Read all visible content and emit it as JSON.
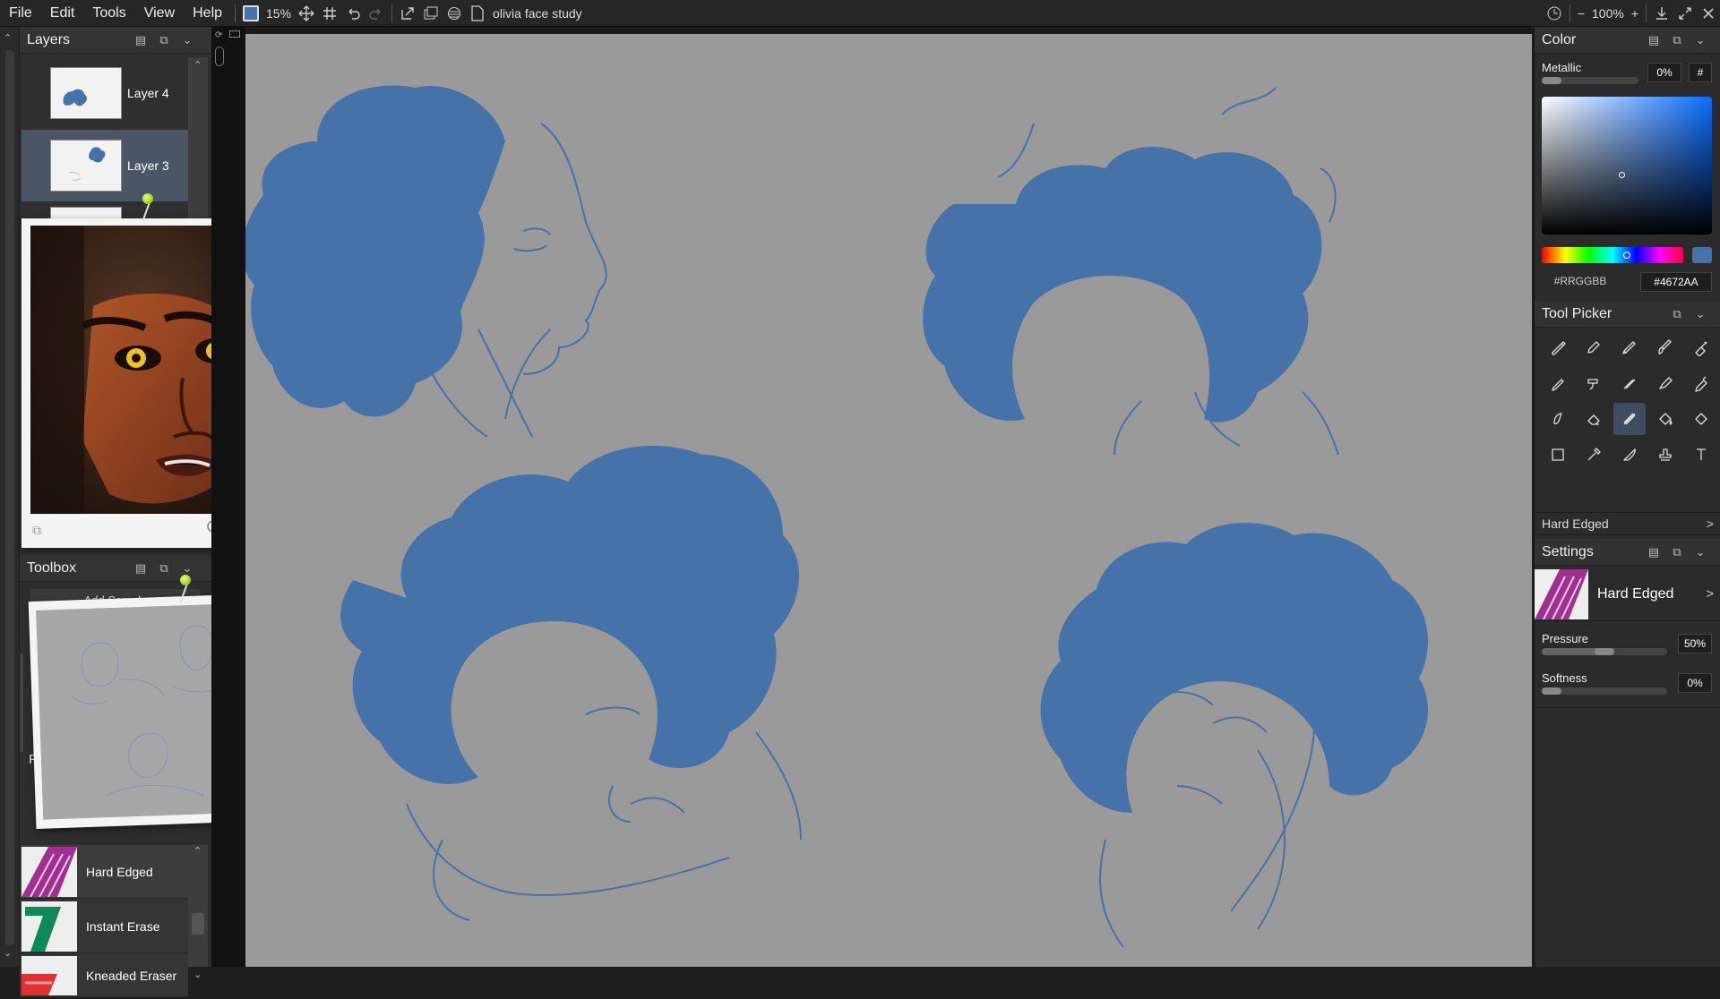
{
  "menu": [
    "File",
    "Edit",
    "Tools",
    "View",
    "Help"
  ],
  "toolbar": {
    "zoom_percent": "15%",
    "document_title": "olivia face study",
    "view_zoom": "100%",
    "view_zoom_minus": "−",
    "view_zoom_plus": "+"
  },
  "layers_panel": {
    "title": "Layers",
    "layers": [
      {
        "name": "Layer 4",
        "selected": false
      },
      {
        "name": "Layer 3",
        "selected": true
      }
    ]
  },
  "toolbox_panel": {
    "title": "Toolbox",
    "add_button": "Add Sample",
    "section_letter": "P",
    "brushes": [
      {
        "name": "Hard Edged",
        "color": "#a03090"
      },
      {
        "name": "Instant Erase",
        "color": "#0e8a5a"
      },
      {
        "name": "Kneaded Eraser",
        "color": "#e03030"
      }
    ]
  },
  "color_panel": {
    "title": "Color",
    "metallic_label": "Metallic",
    "metallic_value": "0%",
    "hash_button": "#",
    "hex_placeholder": "#RRGGBB",
    "hex_value": "#4672AA",
    "current_color": "#4672AA"
  },
  "tool_picker": {
    "title": "Tool Picker",
    "current_tool": "Hard Edged",
    "tool_icons": [
      "pencil-icon",
      "ink-pen-icon",
      "technical-pen-icon",
      "paint-brush-icon",
      "airbrush-icon",
      "pastel-icon",
      "roller-icon",
      "chalk-icon",
      "marker-icon",
      "crayon-icon",
      "smudge-icon",
      "eraser-icon",
      "hard-edged-brush-icon",
      "fill-icon",
      "shape-icon",
      "selection-icon",
      "color-picker-icon",
      "knife-icon",
      "stamp-icon",
      "text-icon"
    ],
    "selected_index": 12
  },
  "settings_panel": {
    "title": "Settings",
    "brush_name": "Hard Edged",
    "pressure_label": "Pressure",
    "pressure_value": "50%",
    "pressure_level": 0.5,
    "softness_label": "Softness",
    "softness_value": "0%",
    "softness_level": 0.0
  },
  "colors": {
    "accent_blue": "#4672AA",
    "canvas_gray": "#9a9a9a",
    "pin_green": "#9ad000"
  }
}
